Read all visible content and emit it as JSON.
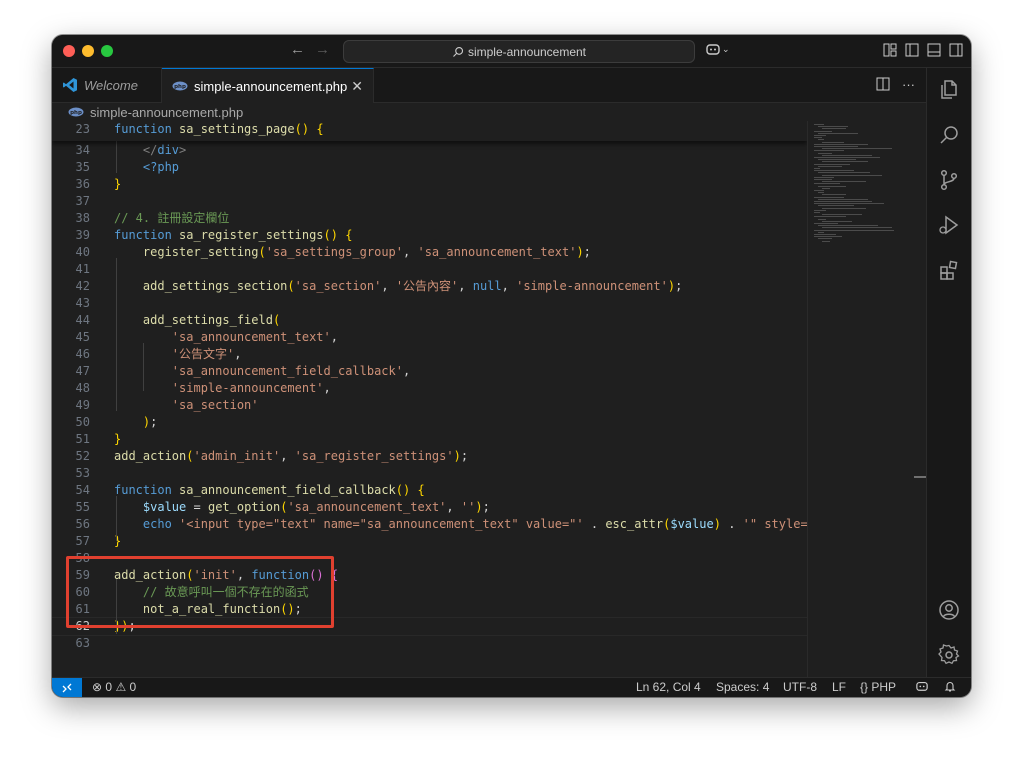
{
  "window": {
    "command_center_text": "simple-announcement"
  },
  "tabs": [
    {
      "label": "Welcome"
    },
    {
      "label": "simple-announcement.php"
    }
  ],
  "breadcrumb": "simple-announcement.php",
  "sticky": {
    "num": "23",
    "text": "function sa_settings_page() {"
  },
  "lines": [
    {
      "num": "34",
      "text": "</div>"
    },
    {
      "num": "35",
      "text": "<?php"
    },
    {
      "num": "36",
      "text": "}"
    },
    {
      "num": "37",
      "text": ""
    },
    {
      "num": "38",
      "text": "// 4. 註冊設定欄位"
    },
    {
      "num": "39",
      "text": "function sa_register_settings() {"
    },
    {
      "num": "40",
      "text": "register_setting('sa_settings_group', 'sa_announcement_text');"
    },
    {
      "num": "41",
      "text": ""
    },
    {
      "num": "42",
      "text": "add_settings_section('sa_section', '公告內容', null, 'simple-announcement');"
    },
    {
      "num": "43",
      "text": ""
    },
    {
      "num": "44",
      "text": "add_settings_field("
    },
    {
      "num": "45",
      "text": "'sa_announcement_text',"
    },
    {
      "num": "46",
      "text": "'公告文字',"
    },
    {
      "num": "47",
      "text": "'sa_announcement_field_callback',"
    },
    {
      "num": "48",
      "text": "'simple-announcement',"
    },
    {
      "num": "49",
      "text": "'sa_section'"
    },
    {
      "num": "50",
      "text": ");"
    },
    {
      "num": "51",
      "text": "}"
    },
    {
      "num": "52",
      "text": "add_action('admin_init', 'sa_register_settings');"
    },
    {
      "num": "53",
      "text": ""
    },
    {
      "num": "54",
      "text": "function sa_announcement_field_callback() {"
    },
    {
      "num": "55",
      "text": "$value = get_option('sa_announcement_text', '');"
    },
    {
      "num": "56",
      "text": "echo '<input type=\"text\" name=\"sa_announcement_text\" value=\"' . esc_attr($value) . '\" style=\"width:"
    },
    {
      "num": "57",
      "text": "}"
    },
    {
      "num": "58",
      "text": ""
    },
    {
      "num": "59",
      "text": "add_action('init', function() {"
    },
    {
      "num": "60",
      "text": "// 故意呼叫一個不存在的函式"
    },
    {
      "num": "61",
      "text": "not_a_real_function();"
    },
    {
      "num": "62",
      "text": "});"
    },
    {
      "num": "63",
      "text": ""
    }
  ],
  "status": {
    "errors": "0",
    "warnings": "0",
    "position": "Ln 62, Col 4",
    "spaces": "Spaces: 4",
    "encoding": "UTF-8",
    "eol": "LF",
    "language": "PHP"
  },
  "icons": {
    "explorer": "files-icon",
    "search": "search-icon",
    "scm": "source-control-icon",
    "debug": "run-debug-icon",
    "extensions": "extensions-icon",
    "account": "account-icon",
    "settings": "gear-icon"
  },
  "colors": {
    "accent": "#0078d4",
    "highlight_box": "#e0402f",
    "keyword": "#569cd6",
    "function": "#dcdcaa",
    "string": "#ce9178",
    "comment": "#6a9955"
  }
}
